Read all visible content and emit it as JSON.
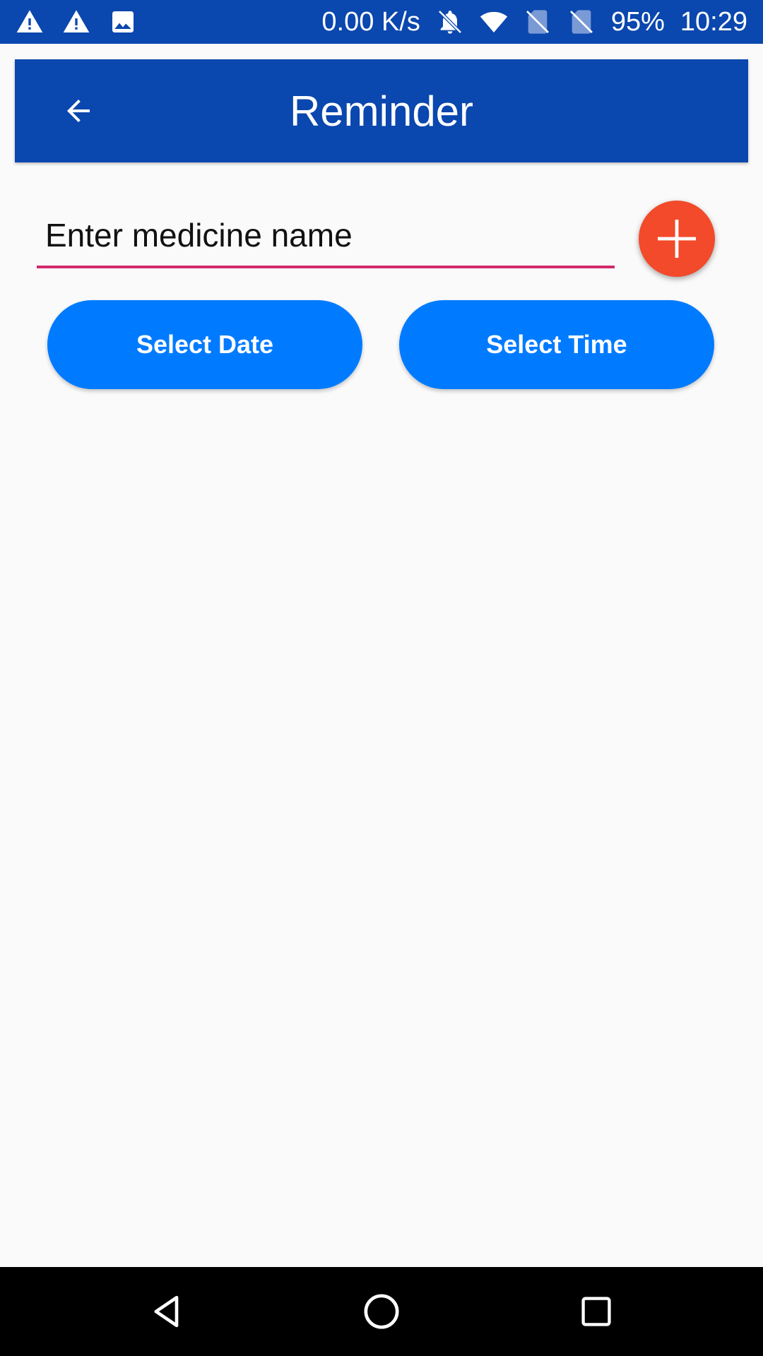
{
  "status_bar": {
    "left_icons": [
      "warning-icon",
      "warning-icon",
      "image-icon"
    ],
    "network_speed": "0.00 K/s",
    "right_icons": [
      "bell-off-icon",
      "wifi-icon",
      "no-sim-icon",
      "no-sim-icon"
    ],
    "battery": "95%",
    "time": "10:29"
  },
  "app_bar": {
    "back_icon": "arrow-back-icon",
    "title": "Reminder",
    "background_color": "#0a47ae"
  },
  "form": {
    "medicine_input": {
      "placeholder": "Enter medicine name",
      "value": ""
    },
    "add_button_icon": "plus-icon",
    "add_button_color": "#f24a2a",
    "select_date_label": "Select Date",
    "select_time_label": "Select Time",
    "button_color": "#007bff"
  },
  "nav_bar": {
    "back_icon": "nav-back-icon",
    "home_icon": "nav-home-icon",
    "recents_icon": "nav-recents-icon"
  }
}
